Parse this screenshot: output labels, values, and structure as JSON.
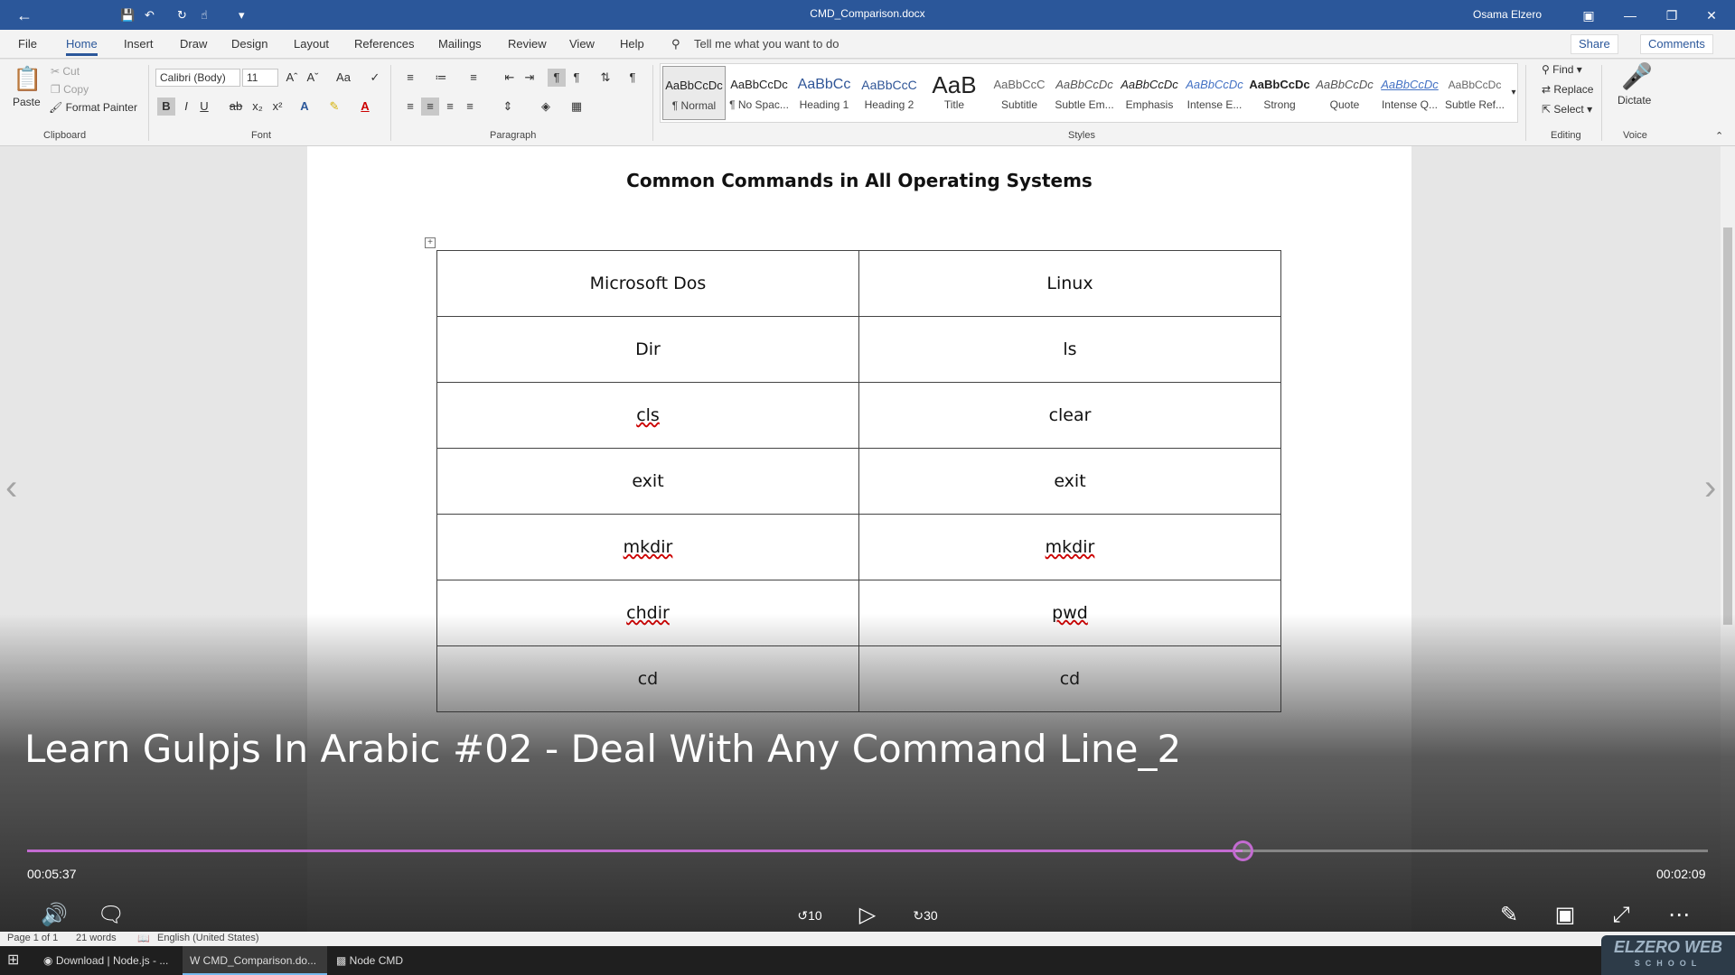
{
  "titlebar": {
    "document_title": "CMD_Comparison.docx",
    "user": "Osama Elzero"
  },
  "tabs": [
    "File",
    "Home",
    "Insert",
    "Draw",
    "Design",
    "Layout",
    "References",
    "Mailings",
    "Review",
    "View",
    "Help"
  ],
  "active_tab": "Home",
  "tell_me": "Tell me what you want to do",
  "share_label": "Share",
  "comments_label": "Comments",
  "clipboard": {
    "paste": "Paste",
    "cut": "Cut",
    "copy": "Copy",
    "format_painter": "Format Painter",
    "group": "Clipboard"
  },
  "font": {
    "family": "Calibri (Body)",
    "size": "11",
    "group": "Font"
  },
  "paragraph": {
    "group": "Paragraph"
  },
  "styles": {
    "group": "Styles",
    "items": [
      {
        "preview": "AaBbCcDc",
        "name": "¶ Normal"
      },
      {
        "preview": "AaBbCcDc",
        "name": "¶ No Spac..."
      },
      {
        "preview": "AaBbCc",
        "name": "Heading 1"
      },
      {
        "preview": "AaBbCcC",
        "name": "Heading 2"
      },
      {
        "preview": "AaB",
        "name": "Title"
      },
      {
        "preview": "AaBbCcC",
        "name": "Subtitle"
      },
      {
        "preview": "AaBbCcDc",
        "name": "Subtle Em..."
      },
      {
        "preview": "AaBbCcDc",
        "name": "Emphasis"
      },
      {
        "preview": "AaBbCcDc",
        "name": "Intense E..."
      },
      {
        "preview": "AaBbCcDc",
        "name": "Strong"
      },
      {
        "preview": "AaBbCcDc",
        "name": "Quote"
      },
      {
        "preview": "AaBbCcDc",
        "name": "Intense Q..."
      },
      {
        "preview": "AaBbCcDc",
        "name": "Subtle Ref..."
      }
    ]
  },
  "editing": {
    "group": "Editing",
    "find": "Find",
    "replace": "Replace",
    "select": "Select"
  },
  "voice": {
    "group": "Voice",
    "dictate": "Dictate"
  },
  "document": {
    "title": "Common Commands in All Operating Systems",
    "table": [
      [
        "Microsoft Dos",
        "Linux"
      ],
      [
        "Dir",
        "ls"
      ],
      [
        "cls",
        "clear"
      ],
      [
        "exit",
        "exit"
      ],
      [
        "mkdir",
        "mkdir"
      ],
      [
        "chdir",
        "pwd"
      ],
      [
        "cd",
        "cd"
      ]
    ]
  },
  "video": {
    "title": "Learn Gulpjs In Arabic #02 - Deal With Any Command Line_2",
    "elapsed": "00:05:37",
    "remaining": "00:02:09",
    "progress": 0.723,
    "rewind_label": "10",
    "forward_label": "30"
  },
  "statusbar": {
    "page": "Page 1 of 1",
    "words": "21 words",
    "language": "English (United States)"
  },
  "taskbar": {
    "items": [
      "Download | Node.js - ...",
      "CMD_Comparison.do...",
      "Node CMD"
    ]
  },
  "watermark": {
    "main": "ELZERO WEB",
    "sub": "SCHOOL"
  },
  "colors": {
    "titlebar": "#2b579a",
    "progress": "#c36bd1"
  }
}
